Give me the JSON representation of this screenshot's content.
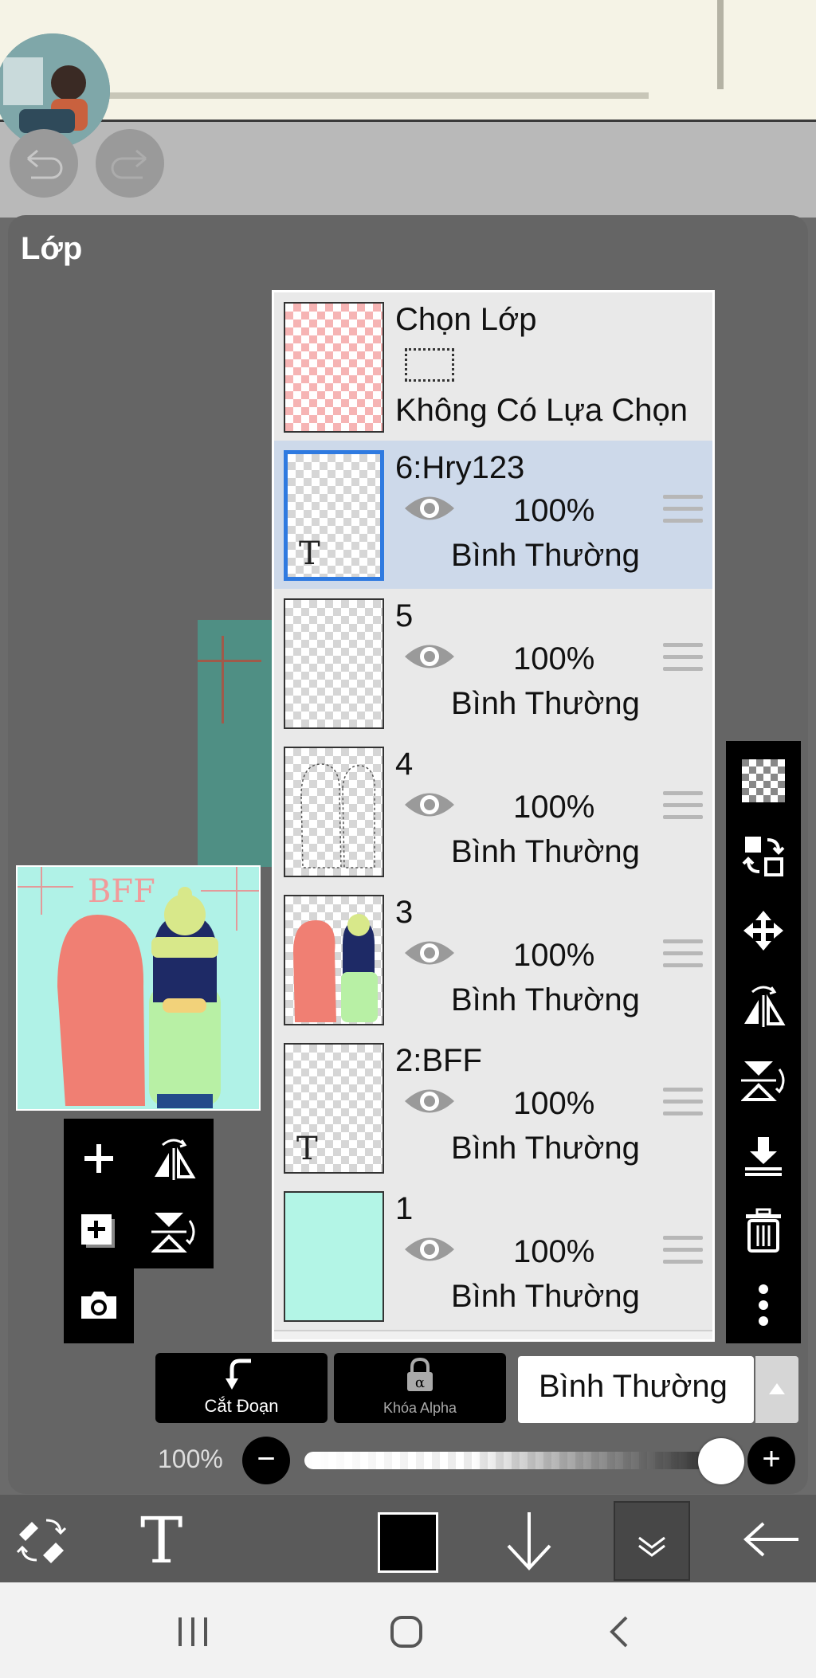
{
  "panel": {
    "title": "Lớp"
  },
  "selection_row": {
    "title": "Chọn Lớp",
    "status": "Không Có Lựa Chọn"
  },
  "layers": [
    {
      "name": "6:Hry123",
      "opacity": "100%",
      "blend": "Bình Thường",
      "type_label": "T",
      "selected": true
    },
    {
      "name": "5",
      "opacity": "100%",
      "blend": "Bình Thường",
      "type_label": "",
      "selected": false
    },
    {
      "name": "4",
      "opacity": "100%",
      "blend": "Bình Thường",
      "type_label": "",
      "selected": false
    },
    {
      "name": "3",
      "opacity": "100%",
      "blend": "Bình Thường",
      "type_label": "",
      "selected": false
    },
    {
      "name": "2:BFF",
      "opacity": "100%",
      "blend": "Bình Thường",
      "type_label": "T",
      "selected": false
    },
    {
      "name": "1",
      "opacity": "100%",
      "blend": "Bình Thường",
      "type_label": "",
      "selected": false
    }
  ],
  "preview": {
    "text": "BFF"
  },
  "controls": {
    "clip_label": "Cắt Đoạn",
    "alpha_lock_label": "Khóa Alpha",
    "blend_mode": "Bình Thường",
    "opacity_label": "100%",
    "opacity_value": 100
  },
  "bottom_toolbar": {
    "text_tool": "T"
  },
  "colors": {
    "selected_row": "#cdd9ea",
    "selection_border": "#2f7ae0",
    "layer1_fill": "#b3f5e6",
    "current_color": "#000000"
  }
}
